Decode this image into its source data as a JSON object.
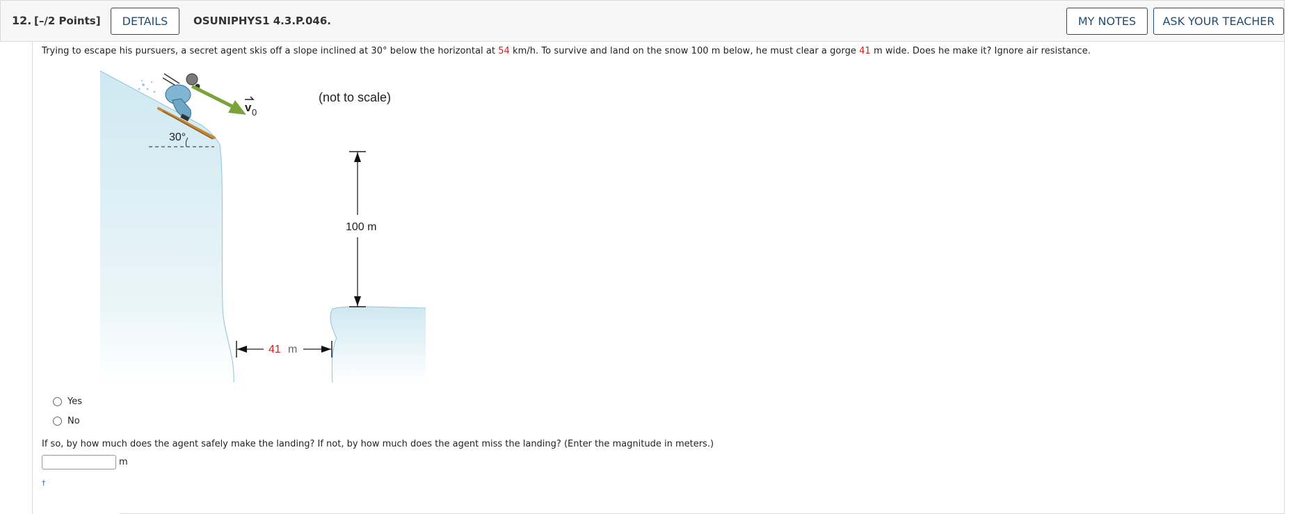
{
  "header": {
    "number": "12.",
    "points": "[–/2 Points]",
    "details_label": "DETAILS",
    "code": "OSUNIPHYS1 4.3.P.046.",
    "notes_label": "MY NOTES",
    "teacher_label": "ASK YOUR TEACHER"
  },
  "question": {
    "part1": "Trying to escape his pursuers, a secret agent skis off a slope inclined at 30° below the horizontal at ",
    "speed": "54",
    "part2": " km/h. To survive and land on the snow 100 m below, he must clear a gorge ",
    "gorge": "41",
    "part3": " m wide. Does he make it? Ignore air resistance."
  },
  "figure": {
    "angle_label": "30°",
    "velocity_label": "v",
    "velocity_subscript": "0",
    "scale_note": "(not to scale)",
    "height_label": "100 m",
    "gap_value": "41",
    "gap_unit": "m",
    "colors": {
      "snow": "#d4ebf3",
      "arrow": "#7aa33a",
      "red": "#d21f1f"
    }
  },
  "options": [
    "Yes",
    "No"
  ],
  "followup": {
    "prompt": "If so, by how much does the agent safely make the landing? If not, by how much does the agent miss the landing? (Enter the magnitude in meters.)",
    "input_value": "",
    "unit": "m",
    "footnote": "†"
  }
}
